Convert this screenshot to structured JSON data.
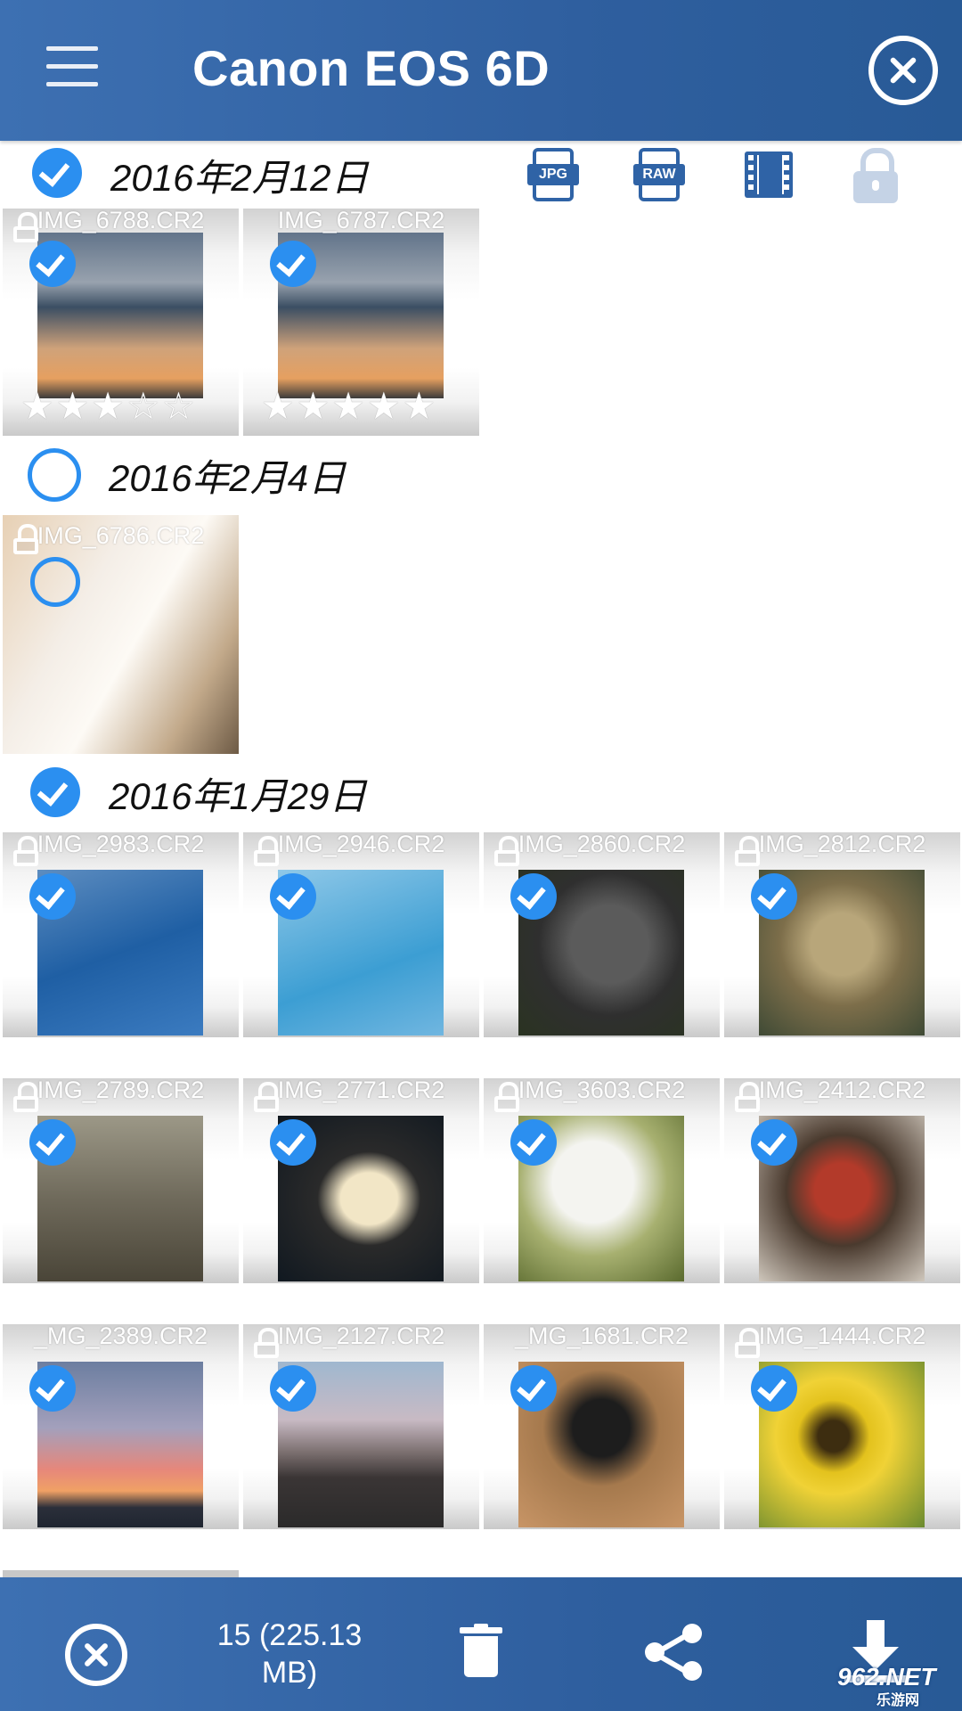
{
  "app": {
    "title": "Canon EOS 6D"
  },
  "filters": {
    "jpg_label": "JPG",
    "raw_label": "RAW"
  },
  "groups": [
    {
      "date": "2016年2月12日",
      "items": [
        {
          "name": "IMG_6788.CR2",
          "rating": "★★★☆☆",
          "rating_value": 3
        },
        {
          "name": "IMG_6787.CR2",
          "rating": "★★★★★",
          "rating_value": 5
        }
      ]
    },
    {
      "date": "2016年2月4日",
      "items": [
        {
          "name": "IMG_6786.CR2"
        }
      ]
    },
    {
      "date": "2016年1月29日",
      "items": [
        {
          "name": "IMG_2983.CR2"
        },
        {
          "name": "IMG_2946.CR2"
        },
        {
          "name": "IMG_2860.CR2"
        },
        {
          "name": "IMG_2812.CR2"
        },
        {
          "name": "IMG_2789.CR2"
        },
        {
          "name": "IMG_2771.CR2"
        },
        {
          "name": "IMG_3603.CR2"
        },
        {
          "name": "IMG_2412.CR2"
        },
        {
          "name": "_MG_2389.CR2"
        },
        {
          "name": "IMG_2127.CR2"
        },
        {
          "name": "_MG_1681.CR2"
        },
        {
          "name": "IMG_1444.CR2"
        }
      ]
    }
  ],
  "footer": {
    "selection_summary": "15 (225.13 MB)"
  },
  "watermark": {
    "main": "962.NET",
    "sub": "乐游网"
  }
}
